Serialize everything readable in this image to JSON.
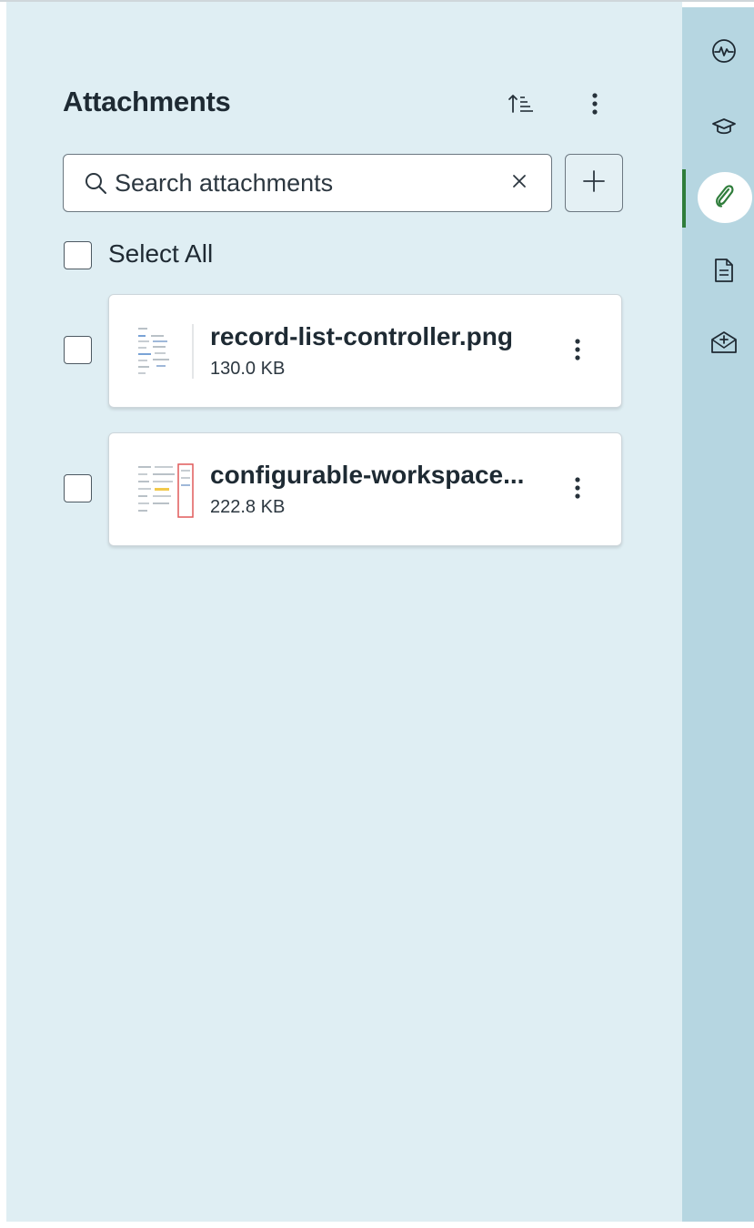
{
  "panel": {
    "title": "Attachments",
    "sort_icon": "sort-ascending-icon",
    "more_icon": "more-vertical-icon"
  },
  "search": {
    "placeholder": "Search attachments",
    "value": "",
    "search_icon": "search-icon",
    "clear_icon": "close-icon"
  },
  "add_icon": "plus-icon",
  "select_all": {
    "label": "Select All",
    "checked": false
  },
  "attachments": [
    {
      "name": "record-list-controller.png",
      "size": "130.0 KB",
      "checked": false
    },
    {
      "name": "configurable-workspace...",
      "size": "222.8 KB",
      "checked": false
    }
  ],
  "rail": {
    "items": [
      {
        "icon": "activity-icon",
        "active": false
      },
      {
        "icon": "graduation-cap-icon",
        "active": false
      },
      {
        "icon": "paperclip-icon",
        "active": true
      },
      {
        "icon": "document-icon",
        "active": false
      },
      {
        "icon": "mail-add-icon",
        "active": false
      }
    ]
  },
  "colors": {
    "panel_bg": "#dfeef3",
    "rail_bg": "#b6d6e1",
    "active_accent": "#2f7d3b"
  }
}
